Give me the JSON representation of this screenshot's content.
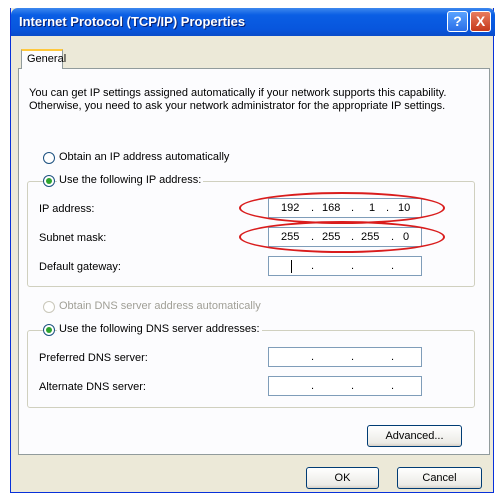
{
  "window": {
    "title": "Internet Protocol (TCP/IP) Properties",
    "help_label": "?",
    "close_label": "X"
  },
  "tabs": [
    {
      "label": "General"
    }
  ],
  "description": "You can get IP settings assigned automatically if your network supports this capability. Otherwise, you need to ask your network administrator for the appropriate IP settings.",
  "ip_options": {
    "auto_label": "Obtain an IP address automatically",
    "manual_label": "Use the following IP address:",
    "selected": "manual"
  },
  "ip_fields": {
    "ip_address": {
      "label": "IP address:",
      "octets": [
        "192",
        "168",
        "1",
        "10"
      ]
    },
    "subnet_mask": {
      "label": "Subnet mask:",
      "octets": [
        "255",
        "255",
        "255",
        "0"
      ]
    },
    "default_gateway": {
      "label": "Default gateway:",
      "octets": [
        "",
        "",
        "",
        ""
      ]
    }
  },
  "dns_options": {
    "auto_label": "Obtain DNS server address automatically",
    "manual_label": "Use the following DNS server addresses:",
    "selected": "manual",
    "auto_disabled": true
  },
  "dns_fields": {
    "preferred": {
      "label": "Preferred DNS server:",
      "octets": [
        "",
        "",
        "",
        ""
      ]
    },
    "alternate": {
      "label": "Alternate DNS server:",
      "octets": [
        "",
        "",
        "",
        ""
      ]
    }
  },
  "buttons": {
    "advanced": "Advanced...",
    "ok": "OK",
    "cancel": "Cancel"
  },
  "annotation_color": "#d91c1c"
}
